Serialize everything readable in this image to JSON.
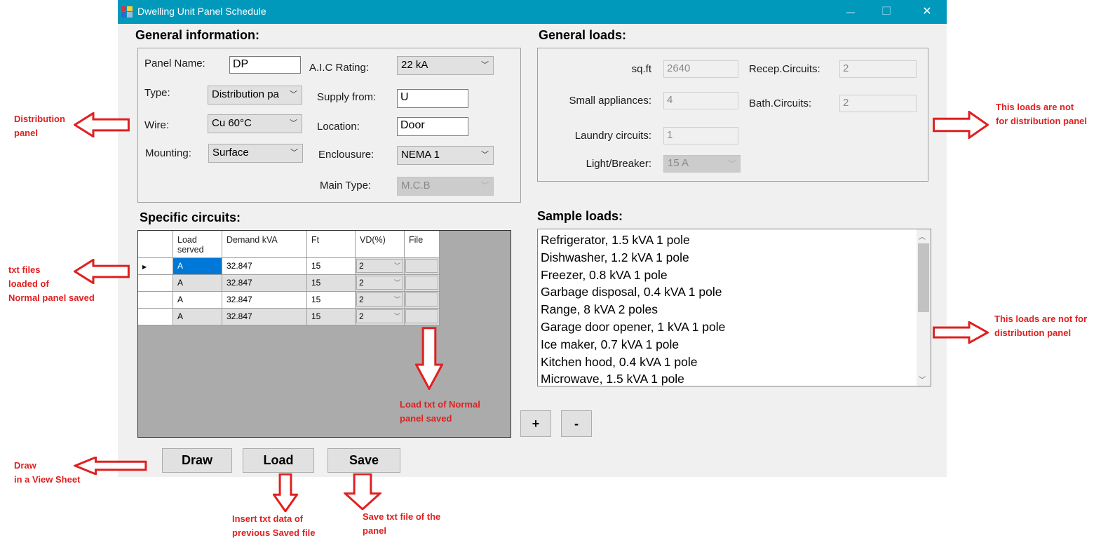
{
  "window": {
    "title": "Dwelling Unit Panel Schedule",
    "minimize": "—",
    "maximize": "☐",
    "close": "✕"
  },
  "general_info": {
    "heading": "General information:",
    "panel_name": {
      "label": "Panel Name:",
      "value": "DP"
    },
    "type": {
      "label": "Type:",
      "value": "Distribution pa"
    },
    "wire": {
      "label": "Wire:",
      "value": "Cu 60°C"
    },
    "mounting": {
      "label": "Mounting:",
      "value": "Surface"
    },
    "aic": {
      "label": "A.I.C Rating:",
      "value": "22 kA"
    },
    "supply": {
      "label": "Supply from:",
      "value": "U"
    },
    "location": {
      "label": "Location:",
      "value": "Door"
    },
    "enclosure": {
      "label": "Enclousure:",
      "value": "NEMA 1"
    },
    "main_type": {
      "label": "Main Type:",
      "value": "M.C.B"
    }
  },
  "general_loads": {
    "heading": "General loads:",
    "sqft": {
      "label": "sq.ft",
      "value": "2640"
    },
    "small": {
      "label": "Small appliances:",
      "value": "4"
    },
    "laundry": {
      "label": "Laundry circuits:",
      "value": "1"
    },
    "light": {
      "label": "Light/Breaker:",
      "value": "15 A"
    },
    "recep": {
      "label": "Recep.Circuits:",
      "value": "2"
    },
    "bath": {
      "label": "Bath.Circuits:",
      "value": "2"
    }
  },
  "specific": {
    "heading": "Specific circuits:",
    "columns": [
      "Load served",
      "Demand kVA",
      "Ft",
      "VD(%)",
      "File"
    ],
    "rows": [
      [
        "A",
        "32.847",
        "15",
        "2",
        ""
      ],
      [
        "A",
        "32.847",
        "15",
        "2",
        ""
      ],
      [
        "A",
        "32.847",
        "15",
        "2",
        ""
      ],
      [
        "A",
        "32.847",
        "15",
        "2",
        ""
      ]
    ]
  },
  "sample": {
    "heading": "Sample loads:",
    "items": [
      "Refrigerator, 1.5 kVA 1 pole",
      "Dishwasher, 1.2 kVA 1 pole",
      "Freezer, 0.8 kVA 1 pole",
      "Garbage disposal, 0.4 kVA 1 pole",
      "Range, 8 kVA 2 poles",
      "Garage door opener, 1 kVA 1 pole",
      "Ice maker, 0.7 kVA 1 pole",
      "Kitchen hood, 0.4 kVA 1 pole",
      "Microwave, 1.5 kVA 1 pole"
    ],
    "add": "+",
    "remove": "-"
  },
  "buttons": {
    "draw": "Draw",
    "load": "Load",
    "save": "Save"
  },
  "annotations": {
    "dist": "Distribution\npanel",
    "txt": "txt files\nloaded of\nNormal panel saved",
    "draw": "Draw\nin a View Sheet",
    "gl": "This loads are not\nfor distribution panel",
    "sl": "This loads are not for\ndistribution panel",
    "file": "Load txt of Normal\npanel saved",
    "load": "Insert txt data of\nprevious Saved file",
    "save": "Save txt file of the\npanel"
  },
  "colors": {
    "titlebar": "#0099bc",
    "annotation": "#e02020",
    "selection": "#0078d7"
  }
}
